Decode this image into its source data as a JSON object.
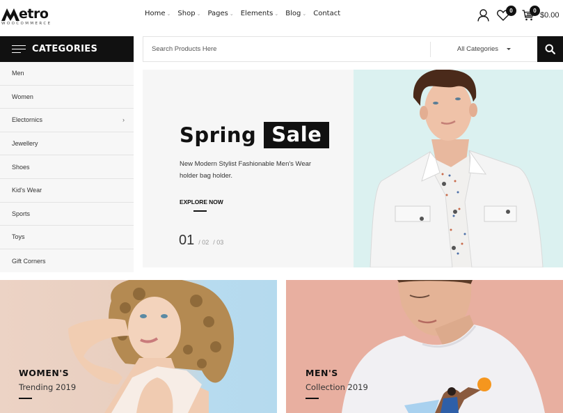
{
  "header": {
    "logo_text": "etro",
    "logo_sub": "WOOCOMMERCE",
    "nav": [
      {
        "label": "Home",
        "has_dropdown": true
      },
      {
        "label": "Shop",
        "has_dropdown": true
      },
      {
        "label": "Pages",
        "has_dropdown": true
      },
      {
        "label": "Elements",
        "has_dropdown": true
      },
      {
        "label": "Blog",
        "has_dropdown": true
      },
      {
        "label": "Contact",
        "has_dropdown": false
      }
    ],
    "dropdown_caret": "⌄",
    "wishlist_count": "0",
    "cart_count": "0",
    "cart_total": "$0.00"
  },
  "categories": {
    "title": "CATEGORIES",
    "items": [
      {
        "label": "Men",
        "submenu": false
      },
      {
        "label": "Women",
        "submenu": false
      },
      {
        "label": "Electornics",
        "submenu": true
      },
      {
        "label": "Jewellery",
        "submenu": false
      },
      {
        "label": "Shoes",
        "submenu": false
      },
      {
        "label": "Kid's Wear",
        "submenu": false
      },
      {
        "label": "Sports",
        "submenu": false
      },
      {
        "label": "Toys",
        "submenu": false
      },
      {
        "label": "Gift Corners",
        "submenu": false
      }
    ],
    "submenu_chevron": "›"
  },
  "search": {
    "placeholder": "Search Products Here",
    "value": "",
    "category_selected": "All Categories"
  },
  "hero": {
    "title_plain": "Spring",
    "title_highlight": "Sale",
    "description": "New Modern Stylist Fashionable Men's Wear holder bag holder.",
    "cta": "EXPLORE NOW",
    "pager_current": "01",
    "pager_others": [
      "/ 02",
      "/ 03"
    ]
  },
  "banners": [
    {
      "heading": "WOMEN'S",
      "subheading": "Trending 2019"
    },
    {
      "heading": "MEN'S",
      "subheading": "Collection 2019"
    }
  ],
  "colors": {
    "primary_dark": "#111111",
    "hero_bg": "#f6f6f6",
    "hero_image_bg": "#dbf1f0",
    "sidebar_bg": "#f7f7f7",
    "men_banner_bg": "#e8afa0"
  }
}
